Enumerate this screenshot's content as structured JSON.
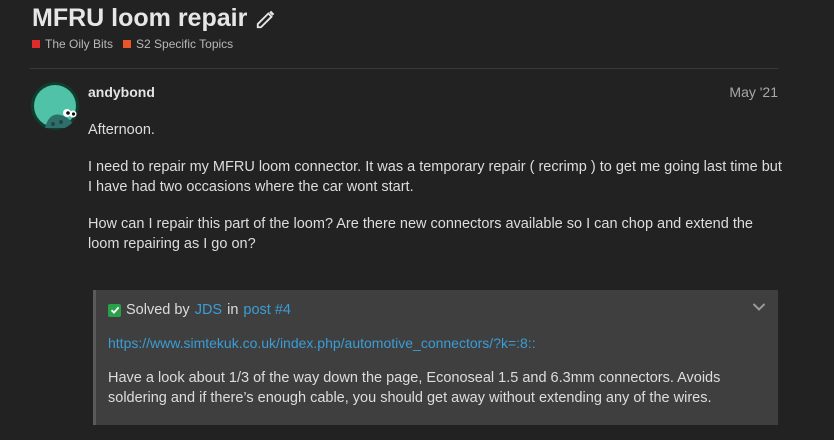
{
  "topic": {
    "title": "MFRU loom repair",
    "categories": [
      {
        "label": "The Oily Bits",
        "color": "#e02b2b"
      },
      {
        "label": "S2 Specific Topics",
        "color": "#e8562a"
      }
    ]
  },
  "post": {
    "username": "andybond",
    "date": "May '21",
    "paragraphs": [
      "Afternoon.",
      "I need to repair my MFRU loom connector. It was a temporary repair ( recrimp ) to get me going last time but I have had two occasions where the car wont start.",
      "How can I repair this part of the loom? Are there new connectors available so I can chop and extend the loom repairing as I go on?"
    ]
  },
  "solution": {
    "prefix": "Solved by",
    "author": "JDS",
    "in_word": "in",
    "post_link": "post #4",
    "url": "https://www.simtekuk.co.uk/index.php/automotive_connectors/?k=:8::",
    "text": "Have a look about 1/3 of the way down the page, Econoseal 1.5 and 6.3mm connectors. Avoids soldering and if there’s enough cable, you should get away without extending any of the wires."
  },
  "icons": {
    "edit": "pencil-icon",
    "solved": "check-icon",
    "expand": "chevron-down-icon"
  }
}
